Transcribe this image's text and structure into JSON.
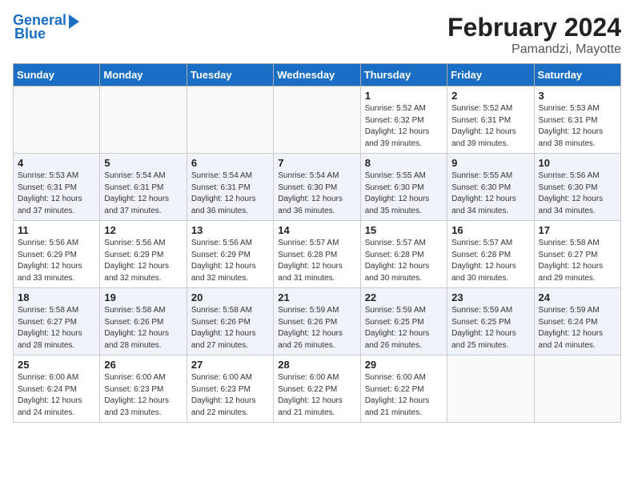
{
  "header": {
    "title": "February 2024",
    "subtitle": "Pamandzi, Mayotte",
    "logo_line1": "General",
    "logo_line2": "Blue"
  },
  "calendar": {
    "days_of_week": [
      "Sunday",
      "Monday",
      "Tuesday",
      "Wednesday",
      "Thursday",
      "Friday",
      "Saturday"
    ],
    "weeks": [
      {
        "row_class": "row-odd",
        "days": [
          {
            "num": "",
            "info": "",
            "empty": true
          },
          {
            "num": "",
            "info": "",
            "empty": true
          },
          {
            "num": "",
            "info": "",
            "empty": true
          },
          {
            "num": "",
            "info": "",
            "empty": true
          },
          {
            "num": "1",
            "info": "Sunrise: 5:52 AM\nSunset: 6:32 PM\nDaylight: 12 hours\nand 39 minutes.",
            "empty": false
          },
          {
            "num": "2",
            "info": "Sunrise: 5:52 AM\nSunset: 6:31 PM\nDaylight: 12 hours\nand 39 minutes.",
            "empty": false
          },
          {
            "num": "3",
            "info": "Sunrise: 5:53 AM\nSunset: 6:31 PM\nDaylight: 12 hours\nand 38 minutes.",
            "empty": false
          }
        ]
      },
      {
        "row_class": "row-even",
        "days": [
          {
            "num": "4",
            "info": "Sunrise: 5:53 AM\nSunset: 6:31 PM\nDaylight: 12 hours\nand 37 minutes.",
            "empty": false
          },
          {
            "num": "5",
            "info": "Sunrise: 5:54 AM\nSunset: 6:31 PM\nDaylight: 12 hours\nand 37 minutes.",
            "empty": false
          },
          {
            "num": "6",
            "info": "Sunrise: 5:54 AM\nSunset: 6:31 PM\nDaylight: 12 hours\nand 36 minutes.",
            "empty": false
          },
          {
            "num": "7",
            "info": "Sunrise: 5:54 AM\nSunset: 6:30 PM\nDaylight: 12 hours\nand 36 minutes.",
            "empty": false
          },
          {
            "num": "8",
            "info": "Sunrise: 5:55 AM\nSunset: 6:30 PM\nDaylight: 12 hours\nand 35 minutes.",
            "empty": false
          },
          {
            "num": "9",
            "info": "Sunrise: 5:55 AM\nSunset: 6:30 PM\nDaylight: 12 hours\nand 34 minutes.",
            "empty": false
          },
          {
            "num": "10",
            "info": "Sunrise: 5:56 AM\nSunset: 6:30 PM\nDaylight: 12 hours\nand 34 minutes.",
            "empty": false
          }
        ]
      },
      {
        "row_class": "row-odd",
        "days": [
          {
            "num": "11",
            "info": "Sunrise: 5:56 AM\nSunset: 6:29 PM\nDaylight: 12 hours\nand 33 minutes.",
            "empty": false
          },
          {
            "num": "12",
            "info": "Sunrise: 5:56 AM\nSunset: 6:29 PM\nDaylight: 12 hours\nand 32 minutes.",
            "empty": false
          },
          {
            "num": "13",
            "info": "Sunrise: 5:56 AM\nSunset: 6:29 PM\nDaylight: 12 hours\nand 32 minutes.",
            "empty": false
          },
          {
            "num": "14",
            "info": "Sunrise: 5:57 AM\nSunset: 6:28 PM\nDaylight: 12 hours\nand 31 minutes.",
            "empty": false
          },
          {
            "num": "15",
            "info": "Sunrise: 5:57 AM\nSunset: 6:28 PM\nDaylight: 12 hours\nand 30 minutes.",
            "empty": false
          },
          {
            "num": "16",
            "info": "Sunrise: 5:57 AM\nSunset: 6:28 PM\nDaylight: 12 hours\nand 30 minutes.",
            "empty": false
          },
          {
            "num": "17",
            "info": "Sunrise: 5:58 AM\nSunset: 6:27 PM\nDaylight: 12 hours\nand 29 minutes.",
            "empty": false
          }
        ]
      },
      {
        "row_class": "row-even",
        "days": [
          {
            "num": "18",
            "info": "Sunrise: 5:58 AM\nSunset: 6:27 PM\nDaylight: 12 hours\nand 28 minutes.",
            "empty": false
          },
          {
            "num": "19",
            "info": "Sunrise: 5:58 AM\nSunset: 6:26 PM\nDaylight: 12 hours\nand 28 minutes.",
            "empty": false
          },
          {
            "num": "20",
            "info": "Sunrise: 5:58 AM\nSunset: 6:26 PM\nDaylight: 12 hours\nand 27 minutes.",
            "empty": false
          },
          {
            "num": "21",
            "info": "Sunrise: 5:59 AM\nSunset: 6:26 PM\nDaylight: 12 hours\nand 26 minutes.",
            "empty": false
          },
          {
            "num": "22",
            "info": "Sunrise: 5:59 AM\nSunset: 6:25 PM\nDaylight: 12 hours\nand 26 minutes.",
            "empty": false
          },
          {
            "num": "23",
            "info": "Sunrise: 5:59 AM\nSunset: 6:25 PM\nDaylight: 12 hours\nand 25 minutes.",
            "empty": false
          },
          {
            "num": "24",
            "info": "Sunrise: 5:59 AM\nSunset: 6:24 PM\nDaylight: 12 hours\nand 24 minutes.",
            "empty": false
          }
        ]
      },
      {
        "row_class": "row-odd",
        "days": [
          {
            "num": "25",
            "info": "Sunrise: 6:00 AM\nSunset: 6:24 PM\nDaylight: 12 hours\nand 24 minutes.",
            "empty": false
          },
          {
            "num": "26",
            "info": "Sunrise: 6:00 AM\nSunset: 6:23 PM\nDaylight: 12 hours\nand 23 minutes.",
            "empty": false
          },
          {
            "num": "27",
            "info": "Sunrise: 6:00 AM\nSunset: 6:23 PM\nDaylight: 12 hours\nand 22 minutes.",
            "empty": false
          },
          {
            "num": "28",
            "info": "Sunrise: 6:00 AM\nSunset: 6:22 PM\nDaylight: 12 hours\nand 21 minutes.",
            "empty": false
          },
          {
            "num": "29",
            "info": "Sunrise: 6:00 AM\nSunset: 6:22 PM\nDaylight: 12 hours\nand 21 minutes.",
            "empty": false
          },
          {
            "num": "",
            "info": "",
            "empty": true
          },
          {
            "num": "",
            "info": "",
            "empty": true
          }
        ]
      }
    ]
  }
}
